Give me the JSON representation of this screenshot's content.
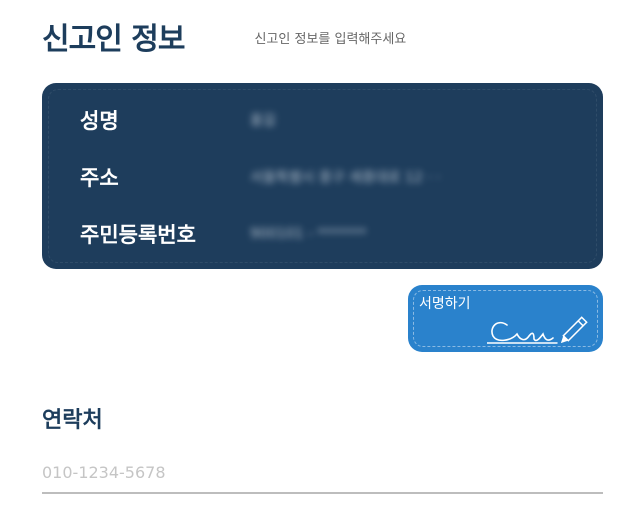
{
  "header": {
    "title": "신고인 정보",
    "subtitle": "신고인 정보를 입력해주세요"
  },
  "reporter_info": {
    "name_label": "성명",
    "name_value": "홍길",
    "address_label": "주소",
    "address_value": "서울특별시 중구 세종대로 12 · ·",
    "rrn_label": "주민등록번호",
    "rrn_value": "900101 - *******"
  },
  "sign_button": {
    "label": "서명하기",
    "icon": "signature-pen-icon"
  },
  "contact": {
    "label": "연락처",
    "value": "",
    "placeholder": "010-1234-5678"
  },
  "colors": {
    "title": "#1d3d5c",
    "card_bg": "#1e3d5c",
    "sign_button_bg": "#2a82cc",
    "placeholder": "#c5c5c5",
    "underline": "#bdbdbd"
  }
}
